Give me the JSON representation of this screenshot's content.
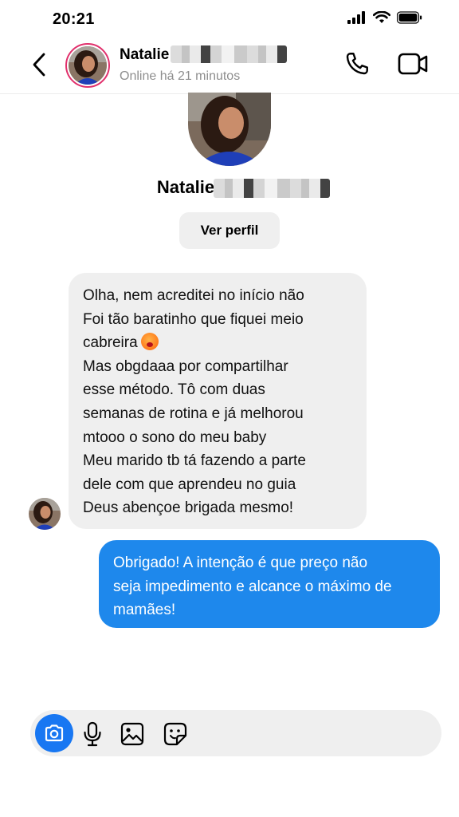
{
  "status_bar": {
    "time": "20:21"
  },
  "header": {
    "name": "Natalie",
    "status": "Online há 21 minutos"
  },
  "profile": {
    "name": "Natalie",
    "view_profile_label": "Ver perfil"
  },
  "messages": {
    "incoming": {
      "lines": [
        "Olha, nem acreditei no início não",
        "Foi tão baratinho que fiquei meio",
        "cabreira",
        "Mas obgdaaa por compartilhar",
        "esse método. Tô com duas",
        "semanas de rotina e já melhorou",
        "mtooo o sono do meu baby",
        "Meu marido tb tá fazendo a parte",
        "dele com que aprendeu no guia",
        "Deus abençoe brigada mesmo!"
      ]
    },
    "outgoing": {
      "lines": [
        "Obrigado! A intenção é que preço não",
        "seja impedimento e alcance o máximo de",
        "mamães!"
      ]
    }
  },
  "colors": {
    "accent_blue": "#1e88ec",
    "bubble_gray": "#efefef",
    "story_ring": "#e1306c"
  }
}
